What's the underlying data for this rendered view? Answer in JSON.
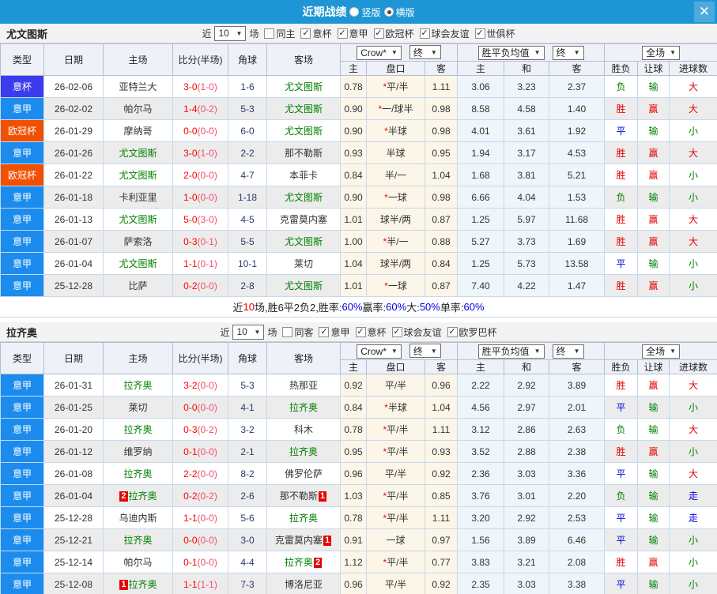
{
  "topbar": {
    "title": "近期战绩",
    "vertical_label": "竖版",
    "horizontal_label": "横版"
  },
  "icons": {
    "close": "✕",
    "dropdown_arrow": "▼",
    "check": "✓"
  },
  "columns": {
    "type": "类型",
    "date": "日期",
    "home": "主场",
    "score": "比分(半场)",
    "corner": "角球",
    "away": "客场",
    "asian_home": "主",
    "handicap": "盘口",
    "asian_away": "客",
    "euro_home": "主",
    "euro_draw": "和",
    "euro_away": "客",
    "result": "胜负",
    "handicap_result": "让球",
    "goals": "进球数"
  },
  "typeColors": {
    "意杯": "#3c3cee",
    "意甲": "#1b8cee",
    "欧冠杯": "#f15000"
  },
  "sections": [
    {
      "team": "尤文图斯",
      "filter": {
        "near_label": "近",
        "count": "10",
        "games_label": "场",
        "same_label": "同主",
        "leagues": [
          "意杯",
          "意甲",
          "欧冠杯",
          "球会友谊",
          "世俱杯"
        ]
      },
      "dropdowns": {
        "crow": "Crow*",
        "end1": "终",
        "avg": "胜平负均值",
        "end2": "终",
        "full": "全场"
      },
      "rows": [
        {
          "type": "意杯",
          "date": "26-02-06",
          "home": "亚特兰大",
          "hg": false,
          "score": "3-0",
          "half": "(1-0)",
          "corner": "1-6",
          "away": "尤文图斯",
          "ag": true,
          "a1": "0.78",
          "star": "*",
          "pan": "平/半",
          "a2": "1.11",
          "e1": "3.06",
          "e2": "3.23",
          "e3": "2.37",
          "r": "负",
          "lb": "输",
          "g": "大"
        },
        {
          "type": "意甲",
          "date": "26-02-02",
          "home": "帕尔马",
          "hg": false,
          "score": "1-4",
          "half": "(0-2)",
          "corner": "5-3",
          "away": "尤文图斯",
          "ag": true,
          "a1": "0.90",
          "star": "*",
          "pan": "一/球半",
          "a2": "0.98",
          "e1": "8.58",
          "e2": "4.58",
          "e3": "1.40",
          "r": "胜",
          "lb": "赢",
          "g": "大"
        },
        {
          "type": "欧冠杯",
          "date": "26-01-29",
          "home": "摩纳哥",
          "hg": false,
          "score": "0-0",
          "half": "(0-0)",
          "corner": "6-0",
          "away": "尤文图斯",
          "ag": true,
          "a1": "0.90",
          "star": "*",
          "pan": "半球",
          "a2": "0.98",
          "e1": "4.01",
          "e2": "3.61",
          "e3": "1.92",
          "r": "平",
          "lb": "输",
          "g": "小"
        },
        {
          "type": "意甲",
          "date": "26-01-26",
          "home": "尤文图斯",
          "hg": true,
          "score": "3-0",
          "half": "(1-0)",
          "corner": "2-2",
          "away": "那不勒斯",
          "ag": false,
          "a1": "0.93",
          "pan": "半球",
          "a2": "0.95",
          "e1": "1.94",
          "e2": "3.17",
          "e3": "4.53",
          "r": "胜",
          "lb": "赢",
          "g": "大"
        },
        {
          "type": "欧冠杯",
          "date": "26-01-22",
          "home": "尤文图斯",
          "hg": true,
          "score": "2-0",
          "half": "(0-0)",
          "corner": "4-7",
          "away": "本菲卡",
          "ag": false,
          "a1": "0.84",
          "pan": "半/一",
          "a2": "1.04",
          "e1": "1.68",
          "e2": "3.81",
          "e3": "5.21",
          "r": "胜",
          "lb": "赢",
          "g": "小"
        },
        {
          "type": "意甲",
          "date": "26-01-18",
          "home": "卡利亚里",
          "hg": false,
          "score": "1-0",
          "half": "(0-0)",
          "corner": "1-18",
          "away": "尤文图斯",
          "ag": true,
          "a1": "0.90",
          "star": "*",
          "pan": "一球",
          "a2": "0.98",
          "e1": "6.66",
          "e2": "4.04",
          "e3": "1.53",
          "r": "负",
          "lb": "输",
          "g": "小"
        },
        {
          "type": "意甲",
          "date": "26-01-13",
          "home": "尤文图斯",
          "hg": true,
          "score": "5-0",
          "half": "(3-0)",
          "corner": "4-5",
          "away": "克雷莫内塞",
          "ag": false,
          "a1": "1.01",
          "pan": "球半/两",
          "a2": "0.87",
          "e1": "1.25",
          "e2": "5.97",
          "e3": "11.68",
          "r": "胜",
          "lb": "赢",
          "g": "大"
        },
        {
          "type": "意甲",
          "date": "26-01-07",
          "home": "萨索洛",
          "hg": false,
          "score": "0-3",
          "half": "(0-1)",
          "corner": "5-5",
          "away": "尤文图斯",
          "ag": true,
          "a1": "1.00",
          "star": "*",
          "pan": "半/一",
          "a2": "0.88",
          "e1": "5.27",
          "e2": "3.73",
          "e3": "1.69",
          "r": "胜",
          "lb": "赢",
          "g": "大"
        },
        {
          "type": "意甲",
          "date": "26-01-04",
          "home": "尤文图斯",
          "hg": true,
          "score": "1-1",
          "half": "(0-1)",
          "corner": "10-1",
          "away": "莱切",
          "ag": false,
          "a1": "1.04",
          "pan": "球半/两",
          "a2": "0.84",
          "e1": "1.25",
          "e2": "5.73",
          "e3": "13.58",
          "r": "平",
          "lb": "输",
          "g": "小"
        },
        {
          "type": "意甲",
          "date": "25-12-28",
          "home": "比萨",
          "hg": false,
          "score": "0-2",
          "half": "(0-0)",
          "corner": "2-8",
          "away": "尤文图斯",
          "ag": true,
          "a1": "1.01",
          "star": "*",
          "pan": "一球",
          "a2": "0.87",
          "e1": "7.40",
          "e2": "4.22",
          "e3": "1.47",
          "r": "胜",
          "lb": "赢",
          "g": "小"
        }
      ],
      "summary": [
        {
          "t": "近"
        },
        {
          "t": "10",
          "c": "red"
        },
        {
          "t": "场,胜6平2负2, "
        },
        {
          "t": "胜率:"
        },
        {
          "t": "60%",
          "c": "blue"
        },
        {
          "t": " 赢率:"
        },
        {
          "t": "60%",
          "c": "blue"
        },
        {
          "t": " 大:"
        },
        {
          "t": "50%",
          "c": "blue"
        },
        {
          "t": " 单率:"
        },
        {
          "t": "60%",
          "c": "blue"
        }
      ]
    },
    {
      "team": "拉齐奥",
      "filter": {
        "near_label": "近",
        "count": "10",
        "games_label": "场",
        "same_label": "同客",
        "leagues": [
          "意甲",
          "意杯",
          "球会友谊",
          "欧罗巴杯"
        ]
      },
      "dropdowns": {
        "crow": "Crow*",
        "end1": "终",
        "avg": "胜平负均值",
        "end2": "终",
        "full": "全场"
      },
      "rows": [
        {
          "type": "意甲",
          "date": "26-01-31",
          "home": "拉齐奥",
          "hg": true,
          "score": "3-2",
          "half": "(0-0)",
          "corner": "5-3",
          "away": "热那亚",
          "ag": false,
          "a1": "0.92",
          "pan": "平/半",
          "a2": "0.96",
          "e1": "2.22",
          "e2": "2.92",
          "e3": "3.89",
          "r": "胜",
          "lb": "赢",
          "g": "大"
        },
        {
          "type": "意甲",
          "date": "26-01-25",
          "home": "莱切",
          "hg": false,
          "score": "0-0",
          "half": "(0-0)",
          "corner": "4-1",
          "away": "拉齐奥",
          "ag": true,
          "a1": "0.84",
          "star": "*",
          "pan": "半球",
          "a2": "1.04",
          "e1": "4.56",
          "e2": "2.97",
          "e3": "2.01",
          "r": "平",
          "lb": "输",
          "g": "小"
        },
        {
          "type": "意甲",
          "date": "26-01-20",
          "home": "拉齐奥",
          "hg": true,
          "score": "0-3",
          "half": "(0-2)",
          "corner": "3-2",
          "away": "科木",
          "ag": false,
          "a1": "0.78",
          "star": "*",
          "pan": "平/半",
          "a2": "1.11",
          "e1": "3.12",
          "e2": "2.86",
          "e3": "2.63",
          "r": "负",
          "lb": "输",
          "g": "大"
        },
        {
          "type": "意甲",
          "date": "26-01-12",
          "home": "维罗纳",
          "hg": false,
          "score": "0-1",
          "half": "(0-0)",
          "corner": "2-1",
          "away": "拉齐奥",
          "ag": true,
          "a1": "0.95",
          "star": "*",
          "pan": "平/半",
          "a2": "0.93",
          "e1": "3.52",
          "e2": "2.88",
          "e3": "2.38",
          "r": "胜",
          "lb": "赢",
          "g": "小"
        },
        {
          "type": "意甲",
          "date": "26-01-08",
          "home": "拉齐奥",
          "hg": true,
          "score": "2-2",
          "half": "(0-0)",
          "corner": "8-2",
          "away": "佛罗伦萨",
          "ag": false,
          "a1": "0.96",
          "pan": "平/半",
          "a2": "0.92",
          "e1": "2.36",
          "e2": "3.03",
          "e3": "3.36",
          "r": "平",
          "lb": "输",
          "g": "大"
        },
        {
          "type": "意甲",
          "date": "26-01-04",
          "home": "拉齐奥",
          "hg": true,
          "hc": "2",
          "score": "0-2",
          "half": "(0-2)",
          "corner": "2-6",
          "away": "那不勒斯",
          "ag": false,
          "ac": "1",
          "a1": "1.03",
          "star": "*",
          "pan": "平/半",
          "a2": "0.85",
          "e1": "3.76",
          "e2": "3.01",
          "e3": "2.20",
          "r": "负",
          "lb": "输",
          "g": "走"
        },
        {
          "type": "意甲",
          "date": "25-12-28",
          "home": "乌迪内斯",
          "hg": false,
          "score": "1-1",
          "half": "(0-0)",
          "corner": "5-6",
          "away": "拉齐奥",
          "ag": true,
          "a1": "0.78",
          "star": "*",
          "pan": "平/半",
          "a2": "1.11",
          "e1": "3.20",
          "e2": "2.92",
          "e3": "2.53",
          "r": "平",
          "lb": "输",
          "g": "走"
        },
        {
          "type": "意甲",
          "date": "25-12-21",
          "home": "拉齐奥",
          "hg": true,
          "score": "0-0",
          "half": "(0-0)",
          "corner": "3-0",
          "away": "克雷莫内塞",
          "ag": false,
          "ac": "1",
          "a1": "0.91",
          "pan": "一球",
          "a2": "0.97",
          "e1": "1.56",
          "e2": "3.89",
          "e3": "6.46",
          "r": "平",
          "lb": "输",
          "g": "小"
        },
        {
          "type": "意甲",
          "date": "25-12-14",
          "home": "帕尔马",
          "hg": false,
          "score": "0-1",
          "half": "(0-0)",
          "corner": "4-4",
          "away": "拉齐奥",
          "ag": true,
          "ac": "2",
          "a1": "1.12",
          "star": "*",
          "pan": "平/半",
          "a2": "0.77",
          "e1": "3.83",
          "e2": "3.21",
          "e3": "2.08",
          "r": "胜",
          "lb": "赢",
          "g": "小"
        },
        {
          "type": "意甲",
          "date": "25-12-08",
          "home": "拉齐奥",
          "hg": true,
          "hc": "1",
          "score": "1-1",
          "half": "(1-1)",
          "corner": "7-3",
          "away": "博洛尼亚",
          "ag": false,
          "a1": "0.96",
          "pan": "平/半",
          "a2": "0.92",
          "e1": "2.35",
          "e2": "3.03",
          "e3": "3.38",
          "r": "平",
          "lb": "输",
          "g": "小"
        }
      ],
      "summary": null
    }
  ]
}
